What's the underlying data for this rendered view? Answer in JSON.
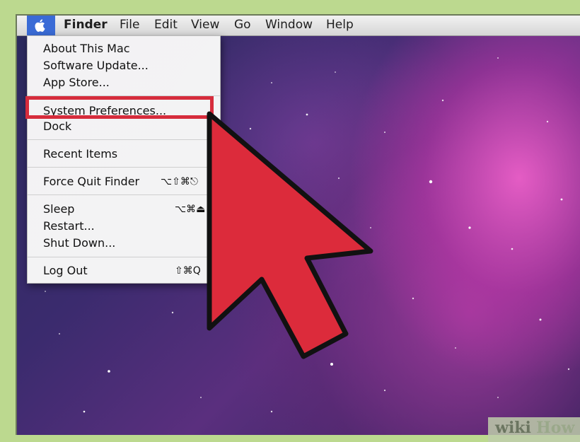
{
  "menubar": {
    "apple_icon": "apple-icon",
    "items": [
      "Finder",
      "File",
      "Edit",
      "View",
      "Go",
      "Window",
      "Help"
    ]
  },
  "apple_menu": {
    "items": [
      {
        "label": "About This Mac"
      },
      {
        "label": "Software Update..."
      },
      {
        "label": "App Store..."
      },
      {
        "label": "System Preferences..."
      },
      {
        "label": "Dock",
        "submenu": true
      },
      {
        "label": "Recent Items",
        "submenu": true
      },
      {
        "label": "Force Quit Finder",
        "shortcut": "⌥⇧⌘⎋"
      },
      {
        "label": "Sleep",
        "shortcut": "⌥⌘⏏"
      },
      {
        "label": "Restart..."
      },
      {
        "label": "Shut Down..."
      },
      {
        "label": "Log Out",
        "shortcut": "⇧⌘Q"
      }
    ]
  },
  "annotation": {
    "highlight_color": "#d62c3c",
    "pointer_icon": "arrow-pointer-icon"
  },
  "watermark": {
    "part1": "wiki",
    "part2": "How"
  }
}
